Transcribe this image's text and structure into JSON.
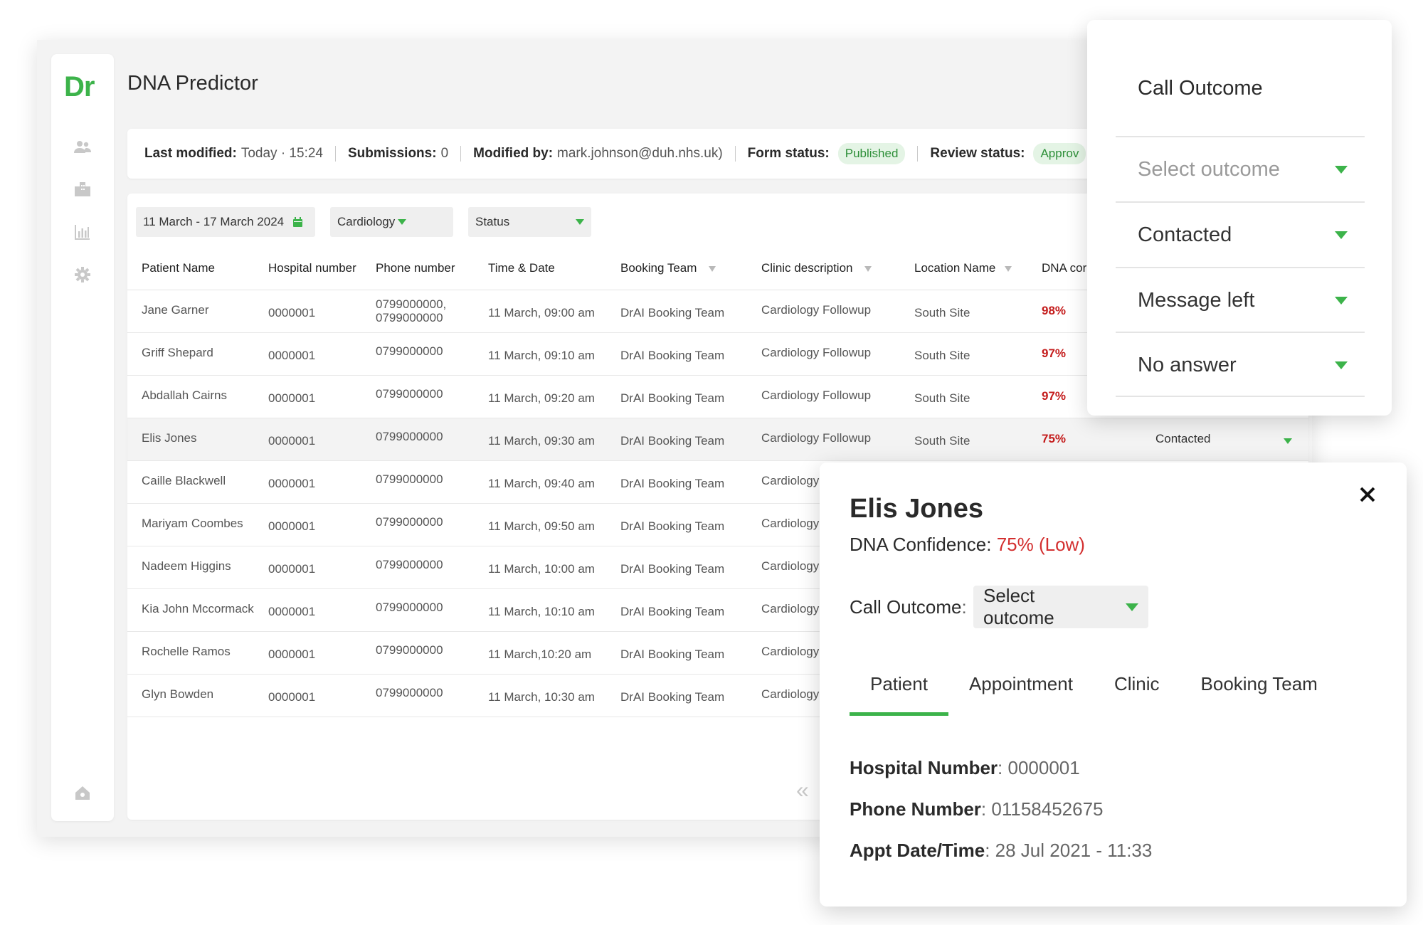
{
  "app": {
    "logo": "Dr",
    "title": "DNA Predictor"
  },
  "sidebar": {
    "icons": [
      "users-icon",
      "building-icon",
      "bar-chart-icon",
      "gear-icon",
      "home-icon"
    ]
  },
  "info_bar": {
    "last_modified_label": "Last modified:",
    "last_modified_value": "Today · 15:24",
    "submissions_label": "Submissions:",
    "submissions_value": "0",
    "modified_by_label": "Modified by:",
    "modified_by_value": "mark.johnson@duh.nhs.uk)",
    "form_status_label": "Form status:",
    "form_status_value": "Published",
    "review_status_label": "Review status:",
    "review_status_value": "Approv"
  },
  "filters": {
    "date_range": "11 March - 17 March 2024",
    "specialty": "Cardiology",
    "status": "Status"
  },
  "table": {
    "columns": [
      "Patient Name",
      "Hospital number",
      "Phone number",
      "Time & Date",
      "Booking Team",
      "Clinic description",
      "Location Name",
      "DNA cor"
    ],
    "rows": [
      {
        "name": "Jane Garner",
        "hospital": "0000001",
        "phone": "0799000000,",
        "phone2": "0799000000",
        "time": "11 March, 09:00 am",
        "team": "DrAI Booking Team",
        "clinic": "Cardiology Followup",
        "location": "South Site",
        "conf": "98%"
      },
      {
        "name": "Griff Shepard",
        "hospital": "0000001",
        "phone": "0799000000",
        "phone2": "",
        "time": "11 March, 09:10 am",
        "team": "DrAI Booking Team",
        "clinic": "Cardiology Followup",
        "location": "South Site",
        "conf": "97%"
      },
      {
        "name": "Abdallah Cairns",
        "hospital": "0000001",
        "phone": "0799000000",
        "phone2": "",
        "time": "11 March, 09:20 am",
        "team": "DrAI Booking Team",
        "clinic": "Cardiology Followup",
        "location": "South Site",
        "conf": "97%"
      },
      {
        "name": "Elis Jones",
        "hospital": "0000001",
        "phone": "0799000000",
        "phone2": "",
        "time": "11 March, 09:30 am",
        "team": "DrAI Booking Team",
        "clinic": "Cardiology Followup",
        "location": "South Site",
        "conf": "75%",
        "outcome": "Contacted"
      },
      {
        "name": "Caille Blackwell",
        "hospital": "0000001",
        "phone": "0799000000",
        "phone2": "",
        "time": "11 March, 09:40 am",
        "team": "DrAI Booking Team",
        "clinic": "Cardiology",
        "location": "",
        "conf": ""
      },
      {
        "name": "Mariyam Coombes",
        "hospital": "0000001",
        "phone": "0799000000",
        "phone2": "",
        "time": "11 March, 09:50 am",
        "team": "DrAI Booking Team",
        "clinic": "Cardiology",
        "location": "",
        "conf": ""
      },
      {
        "name": "Nadeem Higgins",
        "hospital": "0000001",
        "phone": "0799000000",
        "phone2": "",
        "time": "11 March, 10:00 am",
        "team": "DrAI Booking Team",
        "clinic": "Cardiology",
        "location": "",
        "conf": ""
      },
      {
        "name": "Kia John Mccormack",
        "hospital": "0000001",
        "phone": "0799000000",
        "phone2": "",
        "time": "11 March, 10:10 am",
        "team": "DrAI Booking Team",
        "clinic": "Cardiology",
        "location": "",
        "conf": ""
      },
      {
        "name": "Rochelle Ramos",
        "hospital": "0000001",
        "phone": "0799000000",
        "phone2": "",
        "time": "11 March,10:20 am",
        "team": "DrAI Booking Team",
        "clinic": "Cardiology",
        "location": "",
        "conf": ""
      },
      {
        "name": "Glyn Bowden",
        "hospital": "0000001",
        "phone": "0799000000",
        "phone2": "",
        "time": "11 March, 10:30 am",
        "team": "DrAI Booking Team",
        "clinic": "Cardiology",
        "location": "",
        "conf": ""
      }
    ],
    "pager_icon": "«"
  },
  "outcome_panel": {
    "title": "Call Outcome",
    "options": [
      "Select outcome",
      "Contacted",
      "Message left",
      "No answer"
    ]
  },
  "detail": {
    "name": "Elis Jones",
    "conf_label": "DNA Confidence:",
    "conf_value": "75% (Low)",
    "call_outcome_label": "Call Outcome",
    "call_outcome_colon": ":",
    "call_outcome_value": "Select outcome",
    "tabs": [
      "Patient",
      "Appointment",
      "Clinic",
      "Booking Team"
    ],
    "hospital_label": "Hospital Number",
    "hospital_value": ": 0000001",
    "phone_label": "Phone Number",
    "phone_value": ": 01158452675",
    "appt_label": "Appt Date/Time",
    "appt_value": ": 28 Jul 2021 - 11:33"
  },
  "colors": {
    "brand_green": "#3cb34a",
    "confidence_red": "#c41c1c"
  }
}
